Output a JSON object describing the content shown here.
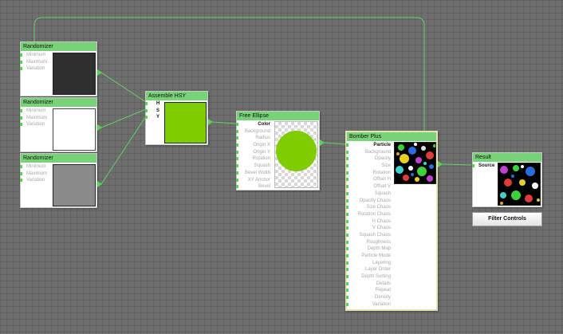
{
  "colors": {
    "node_header": "#78d278",
    "wire": "#5fd35f",
    "port": "#57d357",
    "inactive_label": "#a8a8a8",
    "selected_border": "#e6e3b0",
    "canvas": "#6e6e6e"
  },
  "randomizer1": {
    "title": "Randomizer",
    "ports": [
      "Minimum",
      "Maximum",
      "Variation"
    ],
    "preview_color": "#2f2f2f"
  },
  "randomizer2": {
    "title": "Randomizer",
    "ports": [
      "Minimum",
      "Maximum",
      "Variation"
    ],
    "preview_color": "#ffffff"
  },
  "randomizer3": {
    "title": "Randomizer",
    "ports": [
      "Minimum",
      "Maximum",
      "Variation"
    ],
    "preview_color": "#8a8a8a"
  },
  "assemble": {
    "title": "Assemble HSY",
    "ports": [
      "H",
      "S",
      "Y"
    ],
    "preview_color": "#7fcc00"
  },
  "ellipse": {
    "title": "Free Ellipse",
    "ports": [
      "Color",
      "Background",
      "Radius",
      "Origin X",
      "Origin Y",
      "Rotation",
      "Squash",
      "Bevel Width",
      "XY Anchor",
      "Bevel"
    ],
    "fill_color": "#7fcc00"
  },
  "bomber": {
    "title": "Bomber Plus",
    "ports": [
      "Particle",
      "Background",
      "Opacity",
      "Size",
      "Rotation",
      "Offset H",
      "Offset V",
      "Squash",
      "Opacity Chaos",
      "Size Chaos",
      "Rotation Chaos",
      "H Chaos",
      "V Chaos",
      "Squash Chaos",
      "Roughness",
      "Depth Map",
      "Particle Mode",
      "Layering",
      "Layer Order",
      "Depth Sorting",
      "Details",
      "Repeat",
      "Density",
      "Variation"
    ]
  },
  "result": {
    "title": "Result",
    "ports": [
      "Source"
    ]
  },
  "filter_controls": {
    "label": "Filter Controls"
  }
}
